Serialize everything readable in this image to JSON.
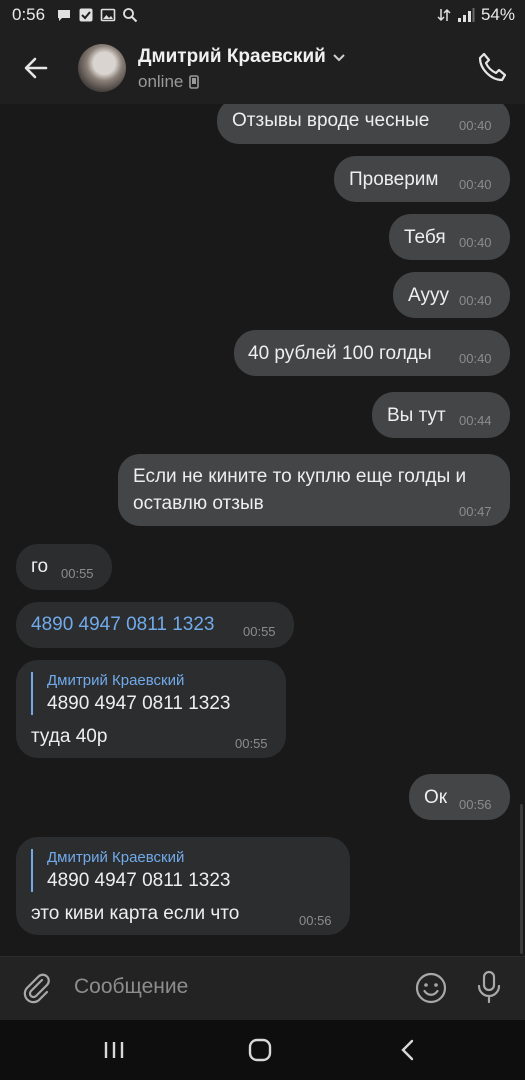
{
  "status_bar": {
    "time": "0:56",
    "battery": "54%"
  },
  "header": {
    "contact_name": "Дмитрий Краевский",
    "status": "online"
  },
  "messages": [
    {
      "dir": "out",
      "text": "Отзывы вроде чесные",
      "time": "00:40"
    },
    {
      "dir": "out",
      "text": "Проверим",
      "time": "00:40"
    },
    {
      "dir": "out",
      "text": "Тебя",
      "time": "00:40"
    },
    {
      "dir": "out",
      "text": "Аууу",
      "time": "00:40"
    },
    {
      "dir": "out",
      "text": "40 рублей 100 голды",
      "time": "00:40"
    },
    {
      "dir": "out",
      "text": "Вы тут",
      "time": "00:44"
    },
    {
      "dir": "out",
      "text_line1": "Если не кините то куплю еще голды и",
      "text_line2": "оставлю отзыв",
      "time": "00:47"
    },
    {
      "dir": "in",
      "text": "го",
      "time": "00:55"
    },
    {
      "dir": "in",
      "text": "4890 4947 0811 1323",
      "time": "00:55"
    },
    {
      "dir": "in",
      "quote_name": "Дмитрий Краевский",
      "quote_text": "4890 4947 0811 1323",
      "text": "туда 40р",
      "time": "00:55"
    },
    {
      "dir": "out",
      "text": "Ок",
      "time": "00:56"
    },
    {
      "dir": "in",
      "quote_name": "Дмитрий Краевский",
      "quote_text": "4890 4947 0811 1323",
      "text": "это киви карта если что",
      "time": "00:56"
    }
  ],
  "composer": {
    "placeholder": "Сообщение"
  },
  "colors": {
    "accent": "#71aaeb",
    "bubble_out": "#444546",
    "bubble_in": "#2c2d2e",
    "background": "#19191a"
  }
}
